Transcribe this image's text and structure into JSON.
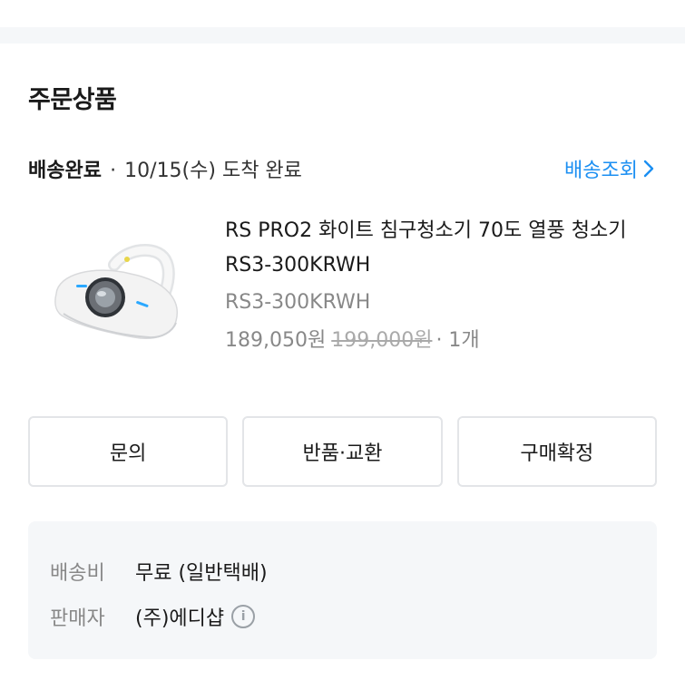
{
  "section": {
    "title": "주문상품"
  },
  "delivery": {
    "status": "배송완료",
    "separator": "·",
    "detail": "10/15(수) 도착 완료",
    "track_label": "배송조회"
  },
  "product": {
    "name": "RS PRO2 화이트 침구청소기 70도 열풍 청소기 RS3-300KRWH",
    "option": "RS3-300KRWH",
    "price": "189,050원",
    "original_price": "199,000원",
    "quantity": "· 1개"
  },
  "actions": {
    "inquiry": "문의",
    "return_exchange": "반품·교환",
    "confirm_purchase": "구매확정"
  },
  "info": {
    "shipping_label": "배송비",
    "shipping_value": "무료 (일반택배)",
    "seller_label": "판매자",
    "seller_value": "(주)에디샵"
  },
  "colors": {
    "link": "#1b8ff2",
    "muted": "#888888",
    "panel": "#f5f7f9"
  }
}
